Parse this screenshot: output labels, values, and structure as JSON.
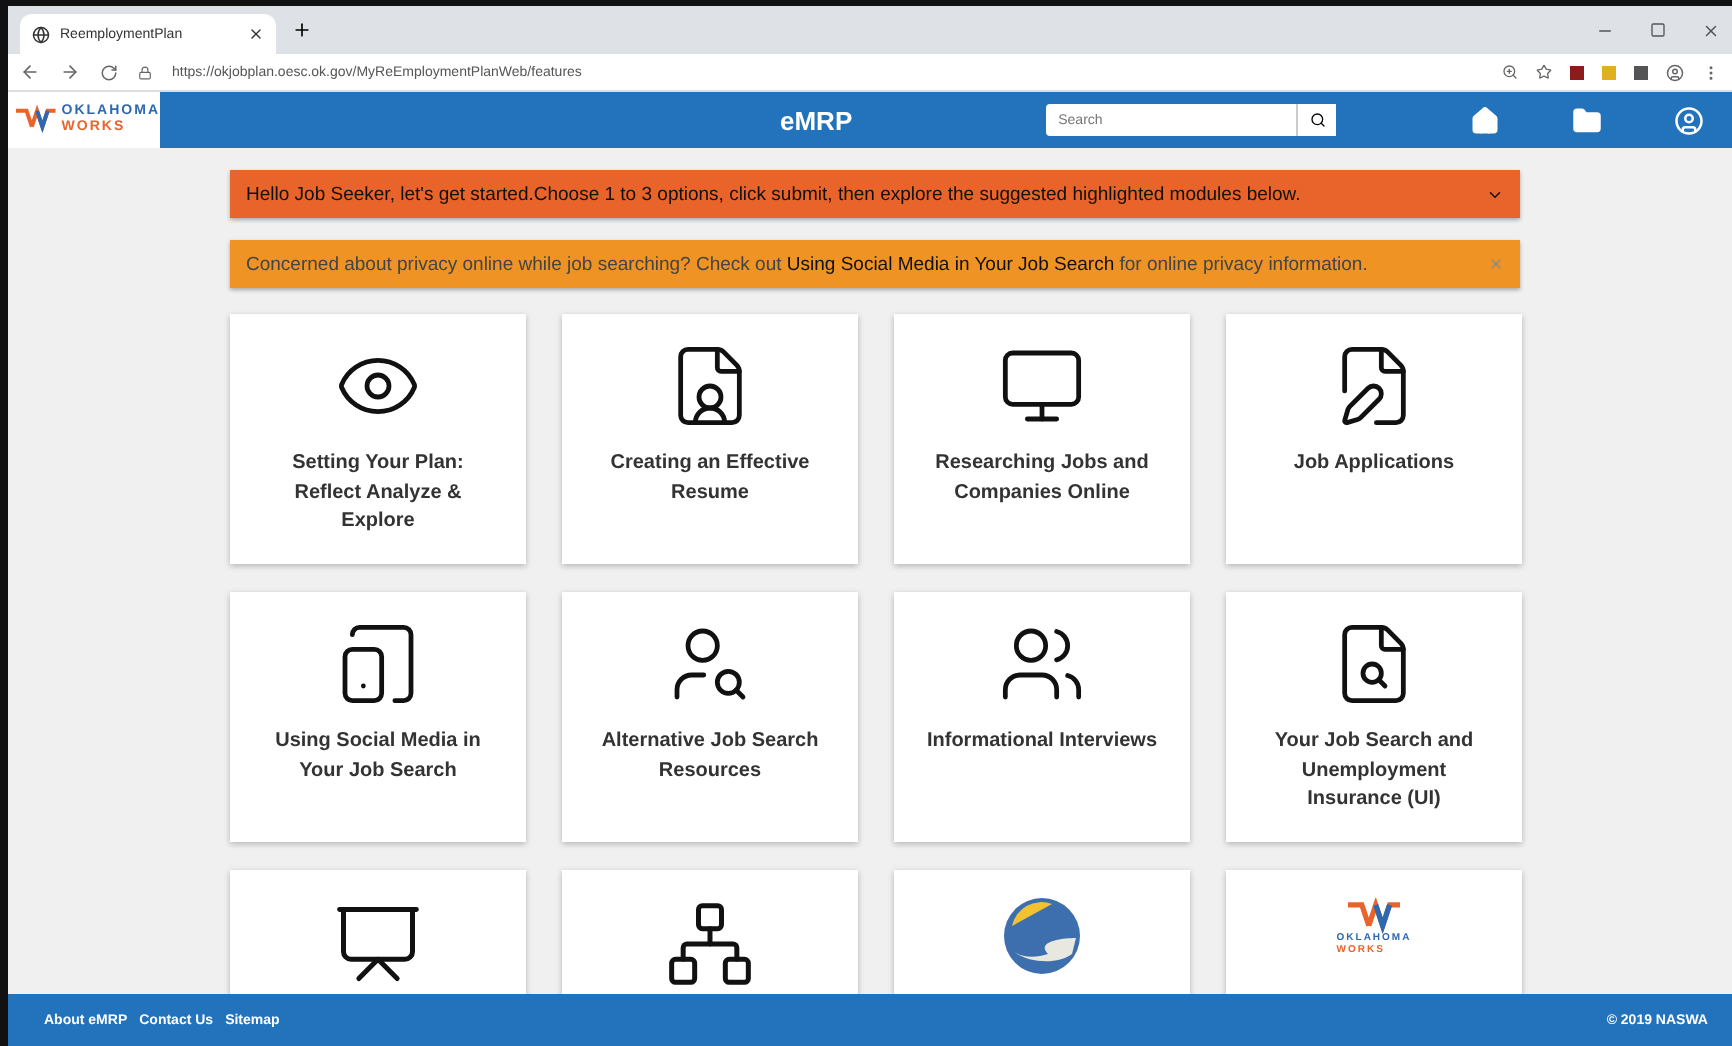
{
  "browser": {
    "tab_title": "ReemploymentPlan",
    "url": "https://okjobplan.oesc.ok.gov/MyReEmploymentPlanWeb/features"
  },
  "header": {
    "logo_lines": [
      "OKLAHOMA",
      "WORKS"
    ],
    "title": "eMRP",
    "search": {
      "placeholder": "Search"
    }
  },
  "banners": [
    {
      "kind": "alert",
      "text": "Hello Job Seeker, let's get started.Choose 1 to 3 options, click submit, then explore the suggested highlighted modules below."
    },
    {
      "kind": "notice",
      "before": "Concerned about privacy online while job searching?   Check out",
      "link": "Using Social Media in Your Job Search",
      "after": "for online privacy information."
    }
  ],
  "cards": [
    {
      "kind": "module",
      "title": "Setting Your Plan: Reflect Analyze & Explore"
    },
    {
      "kind": "module",
      "title": "Creating an Effective Resume"
    },
    {
      "kind": "module",
      "title": "Researching Jobs and Companies Online"
    },
    {
      "kind": "module",
      "title": "Job Applications"
    },
    {
      "kind": "module",
      "title": "Using Social Media in Your Job Search"
    },
    {
      "kind": "module",
      "title": "Alternative Job Search Resources"
    },
    {
      "kind": "module",
      "title": "Informational Interviews"
    },
    {
      "kind": "module",
      "title": "Your Job Search and Unemployment Insurance (UI)"
    },
    {
      "kind": "picture"
    },
    {
      "kind": "picture"
    },
    {
      "kind": "picture"
    },
    {
      "kind": "logo",
      "logo_lines": [
        "OKLAHOMA",
        "WORKS"
      ]
    }
  ],
  "footer": {
    "links": [
      "About eMRP",
      "Contact Us",
      "Sitemap"
    ],
    "copyright": "© 2019 NASWA"
  }
}
